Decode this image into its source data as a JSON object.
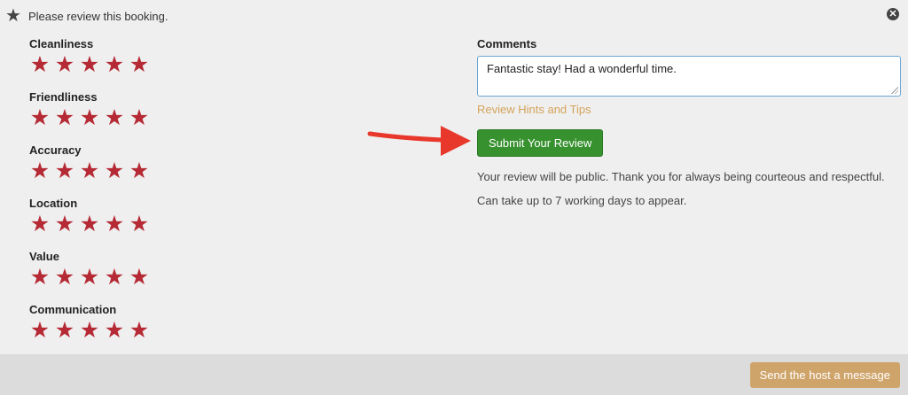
{
  "header": {
    "title": "Please review this booking.",
    "icon": "star-icon",
    "close_icon": "close-icon"
  },
  "ratings": [
    {
      "label": "Cleanliness",
      "stars": 5
    },
    {
      "label": "Friendliness",
      "stars": 5
    },
    {
      "label": "Accuracy",
      "stars": 5
    },
    {
      "label": "Location",
      "stars": 5
    },
    {
      "label": "Value",
      "stars": 5
    },
    {
      "label": "Communication",
      "stars": 5
    }
  ],
  "comments": {
    "label": "Comments",
    "value": "Fantastic stay! Had a wonderful time."
  },
  "hints_link": "Review Hints and Tips",
  "submit_label": "Submit Your Review",
  "notes": [
    "Your review will be public. Thank you for always being courteous and respectful.",
    "Can take up to 7 working days to appear."
  ],
  "footer": {
    "send_label": "Send the host a message"
  },
  "colors": {
    "star": "#b52a34",
    "submit": "#36912e",
    "link": "#d4a35a",
    "send": "#cfa46a",
    "arrow": "#e8382c"
  }
}
